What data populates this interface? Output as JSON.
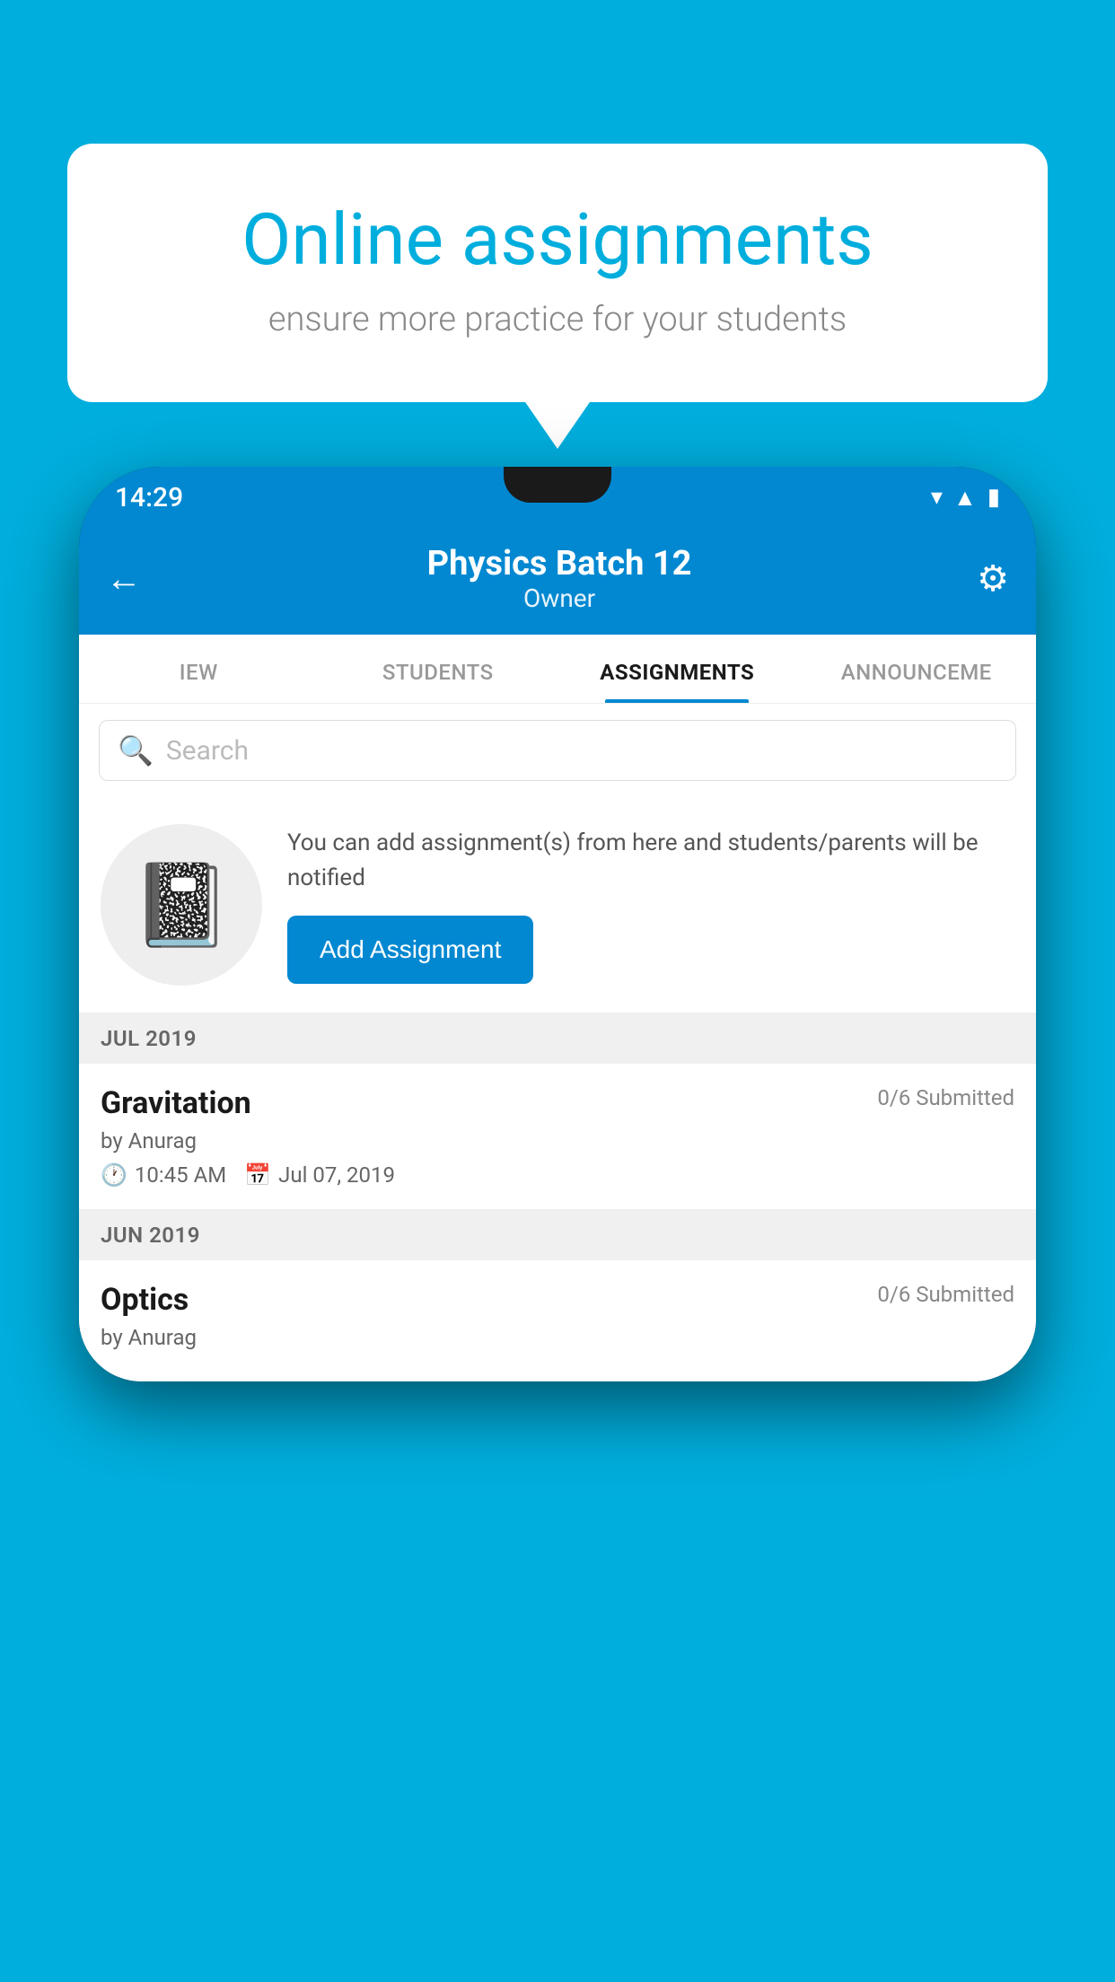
{
  "background_color": "#00AEDD",
  "speech_bubble": {
    "title": "Online assignments",
    "subtitle": "ensure more practice for your students"
  },
  "status_bar": {
    "time": "14:29",
    "icons": [
      "wifi",
      "signal",
      "battery"
    ]
  },
  "header": {
    "title": "Physics Batch 12",
    "subtitle": "Owner",
    "back_icon": "←",
    "settings_icon": "⚙"
  },
  "tabs": [
    {
      "label": "IEW",
      "active": false
    },
    {
      "label": "STUDENTS",
      "active": false
    },
    {
      "label": "ASSIGNMENTS",
      "active": true
    },
    {
      "label": "ANNOUNCEME",
      "active": false
    }
  ],
  "search": {
    "placeholder": "Search"
  },
  "promo": {
    "description": "You can add assignment(s) from here and students/parents will be notified",
    "button_label": "Add Assignment"
  },
  "sections": [
    {
      "label": "JUL 2019",
      "assignments": [
        {
          "name": "Gravitation",
          "submitted": "0/6 Submitted",
          "author": "by Anurag",
          "time": "10:45 AM",
          "date": "Jul 07, 2019"
        }
      ]
    },
    {
      "label": "JUN 2019",
      "assignments": [
        {
          "name": "Optics",
          "submitted": "0/6 Submitted",
          "author": "by Anurag",
          "time": "",
          "date": ""
        }
      ]
    }
  ]
}
